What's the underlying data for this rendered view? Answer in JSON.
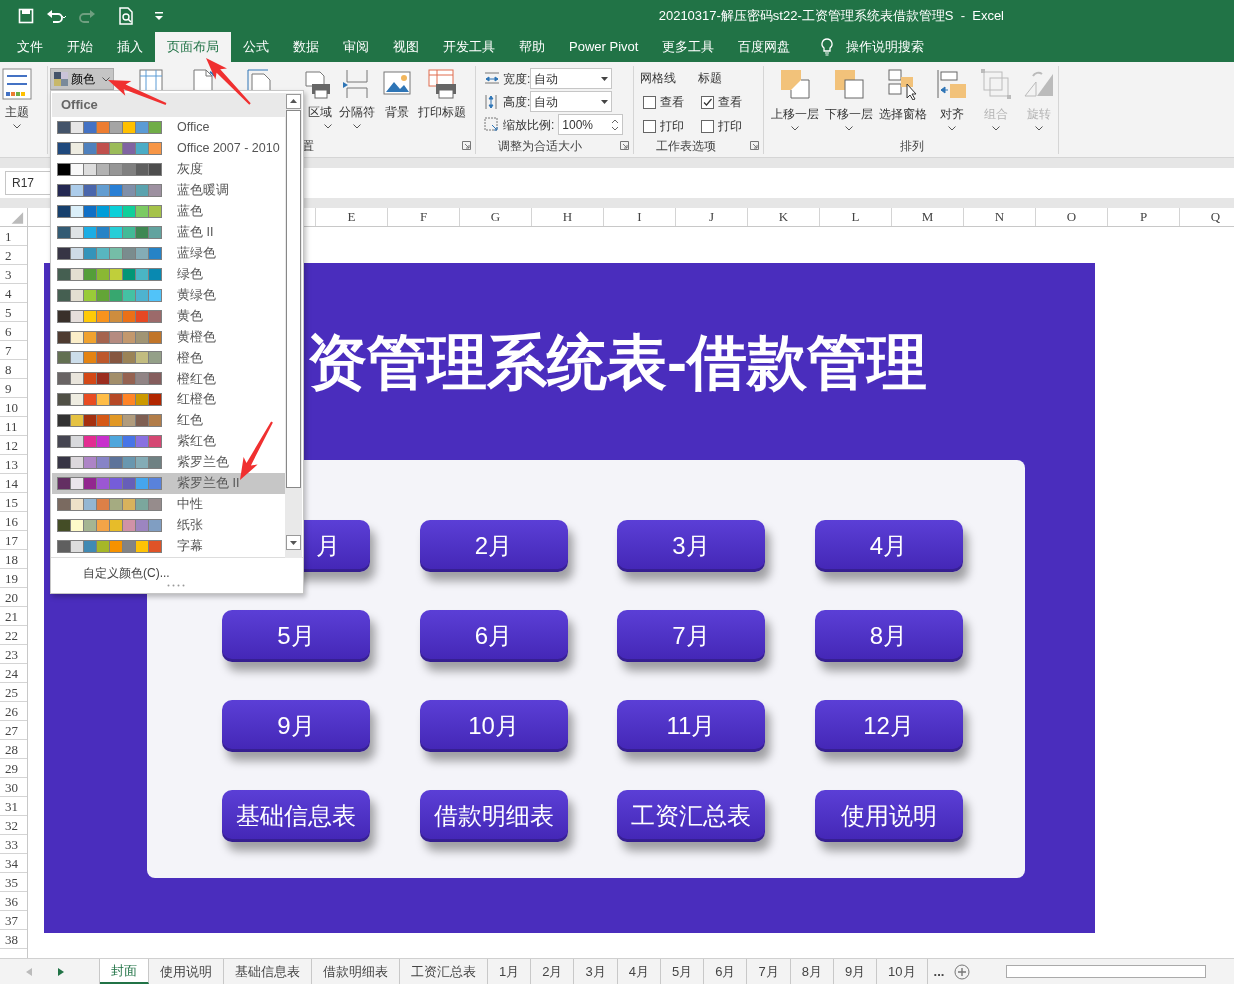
{
  "window": {
    "title": "20210317-解压密码st22-工资管理系统表借款管理S  -  Excel"
  },
  "tabs": [
    {
      "label": "文件",
      "selected": false
    },
    {
      "label": "开始",
      "selected": false
    },
    {
      "label": "插入",
      "selected": false
    },
    {
      "label": "页面布局",
      "selected": true
    },
    {
      "label": "公式",
      "selected": false
    },
    {
      "label": "数据",
      "selected": false
    },
    {
      "label": "审阅",
      "selected": false
    },
    {
      "label": "视图",
      "selected": false
    },
    {
      "label": "开发工具",
      "selected": false
    },
    {
      "label": "帮助",
      "selected": false
    },
    {
      "label": "Power Pivot",
      "selected": false
    },
    {
      "label": "更多工具",
      "selected": false
    },
    {
      "label": "百度网盘",
      "selected": false
    }
  ],
  "tell_me": "操作说明搜索",
  "ribbon": {
    "theme_button": "主题",
    "colors_button": {
      "label": "颜色",
      "pressed": true
    },
    "page_setup": {
      "buttons": [
        {
          "label": "区域",
          "dropdown": true
        },
        {
          "label": "分隔符",
          "dropdown": true
        },
        {
          "label": "背景",
          "dropdown": false
        },
        {
          "label": "打印标题",
          "dropdown": false
        }
      ],
      "group": "置"
    },
    "scale": {
      "fields": [
        {
          "label": "宽度:",
          "value": "自动",
          "kind": "select"
        },
        {
          "label": "高度:",
          "value": "自动",
          "kind": "select"
        },
        {
          "label": "缩放比例:",
          "value": "100%",
          "kind": "spin"
        }
      ],
      "group": "调整为合适大小"
    },
    "sheet_options": {
      "columns": [
        {
          "heading": "网格线",
          "options": [
            {
              "label": "查看",
              "checked": false
            },
            {
              "label": "打印",
              "checked": false
            }
          ]
        },
        {
          "heading": "标题",
          "options": [
            {
              "label": "查看",
              "checked": true
            },
            {
              "label": "打印",
              "checked": false
            }
          ]
        }
      ],
      "group": "工作表选项"
    },
    "arrange": {
      "buttons": [
        {
          "label": "上移一层",
          "dropdown": true,
          "disabled": false
        },
        {
          "label": "下移一层",
          "dropdown": true,
          "disabled": false
        },
        {
          "label": "选择窗格",
          "dropdown": false,
          "disabled": false
        },
        {
          "label": "对齐",
          "dropdown": true,
          "disabled": false
        },
        {
          "label": "组合",
          "dropdown": true,
          "disabled": true
        },
        {
          "label": "旋转",
          "dropdown": true,
          "disabled": true
        }
      ],
      "group": "排列"
    }
  },
  "name_box": "R17",
  "columns": [
    "E",
    "F",
    "G",
    "H",
    "I",
    "J",
    "K",
    "L",
    "M",
    "N",
    "O",
    "P",
    "Q"
  ],
  "rows": [
    "1",
    "2",
    "3",
    "4",
    "5",
    "6",
    "7",
    "8",
    "9",
    "10",
    "11",
    "12",
    "13",
    "14",
    "15",
    "16",
    "17",
    "18",
    "19",
    "20",
    "21",
    "22",
    "23",
    "24",
    "25",
    "26",
    "27",
    "28",
    "29",
    "30",
    "31",
    "32",
    "33",
    "34",
    "35",
    "36",
    "37",
    "38"
  ],
  "sheet": {
    "banner_title": "资管理系统表-借款管理",
    "buttons": [
      "月",
      "2月",
      "3月",
      "4月",
      "5月",
      "6月",
      "7月",
      "8月",
      "9月",
      "10月",
      "11月",
      "12月",
      "基础信息表",
      "借款明细表",
      "工资汇总表",
      "使用说明"
    ]
  },
  "color_menu": {
    "heading": "Office",
    "schemes": [
      {
        "name": "Office",
        "selected": false,
        "swatches": [
          {
            "color": "#44546a"
          },
          {
            "color": "#e7e6e6"
          },
          {
            "color": "#4472c4"
          },
          {
            "color": "#ed7d31"
          },
          {
            "color": "#a5a5a5"
          },
          {
            "color": "#ffc000"
          },
          {
            "color": "#5b9bd5"
          },
          {
            "color": "#70ad47"
          }
        ]
      },
      {
        "name": "Office 2007 - 2010",
        "selected": false,
        "swatches": [
          {
            "color": "#1f497d"
          },
          {
            "color": "#eeece1"
          },
          {
            "color": "#4f81bd"
          },
          {
            "color": "#c0504d"
          },
          {
            "color": "#9bbb59"
          },
          {
            "color": "#8064a2"
          },
          {
            "color": "#4bacc6"
          },
          {
            "color": "#f79646"
          }
        ]
      },
      {
        "name": "灰度",
        "selected": false,
        "swatches": [
          {
            "color": "#000000"
          },
          {
            "color": "#f8f8f8"
          },
          {
            "color": "#dddddd"
          },
          {
            "color": "#b2b2b2"
          },
          {
            "color": "#969696"
          },
          {
            "color": "#808080"
          },
          {
            "color": "#5f5f5f"
          },
          {
            "color": "#4d4d4d"
          }
        ]
      },
      {
        "name": "蓝色暖调",
        "selected": false,
        "swatches": [
          {
            "color": "#242852"
          },
          {
            "color": "#acccea"
          },
          {
            "color": "#4a66ac"
          },
          {
            "color": "#629dd1"
          },
          {
            "color": "#297fd5"
          },
          {
            "color": "#7f8fa9"
          },
          {
            "color": "#5aa2ae"
          },
          {
            "color": "#9d90a0"
          }
        ]
      },
      {
        "name": "蓝色",
        "selected": false,
        "swatches": [
          {
            "color": "#17406d"
          },
          {
            "color": "#dbeff9"
          },
          {
            "color": "#0f6fc6"
          },
          {
            "color": "#009dd9"
          },
          {
            "color": "#0bd0d9"
          },
          {
            "color": "#10cf9b"
          },
          {
            "color": "#7cca62"
          },
          {
            "color": "#a5c249"
          }
        ]
      },
      {
        "name": "蓝色 II",
        "selected": false,
        "swatches": [
          {
            "color": "#335b74"
          },
          {
            "color": "#dfe3e5"
          },
          {
            "color": "#1cade4"
          },
          {
            "color": "#2683c6"
          },
          {
            "color": "#27ced7"
          },
          {
            "color": "#42ba97"
          },
          {
            "color": "#3e8853"
          },
          {
            "color": "#62a39f"
          }
        ]
      },
      {
        "name": "蓝绿色",
        "selected": false,
        "swatches": [
          {
            "color": "#373545"
          },
          {
            "color": "#cedbe6"
          },
          {
            "color": "#3494ba"
          },
          {
            "color": "#58b6c0"
          },
          {
            "color": "#75bda7"
          },
          {
            "color": "#7a8c8e"
          },
          {
            "color": "#84acb6"
          },
          {
            "color": "#2683c6"
          }
        ]
      },
      {
        "name": "绿色",
        "selected": false,
        "swatches": [
          {
            "color": "#455f51"
          },
          {
            "color": "#e3ded1"
          },
          {
            "color": "#549e39"
          },
          {
            "color": "#8ab833"
          },
          {
            "color": "#c0cf3a"
          },
          {
            "color": "#029676"
          },
          {
            "color": "#4ab5c4"
          },
          {
            "color": "#0989b1"
          }
        ]
      },
      {
        "name": "黄绿色",
        "selected": false,
        "swatches": [
          {
            "color": "#455f51"
          },
          {
            "color": "#e3ded1"
          },
          {
            "color": "#99cb38"
          },
          {
            "color": "#63a537"
          },
          {
            "color": "#37a76f"
          },
          {
            "color": "#44c1a3"
          },
          {
            "color": "#4eb3cf"
          },
          {
            "color": "#51c3f9"
          }
        ]
      },
      {
        "name": "黄色",
        "selected": false,
        "swatches": [
          {
            "color": "#39302a"
          },
          {
            "color": "#e5dedb"
          },
          {
            "color": "#ffca08"
          },
          {
            "color": "#f8931d"
          },
          {
            "color": "#ce8d3e"
          },
          {
            "color": "#ec7016"
          },
          {
            "color": "#e64823"
          },
          {
            "color": "#9c6a6a"
          }
        ]
      },
      {
        "name": "黄橙色",
        "selected": false,
        "swatches": [
          {
            "color": "#4e3b30"
          },
          {
            "color": "#fbeec9"
          },
          {
            "color": "#f0a22e"
          },
          {
            "color": "#a5644e"
          },
          {
            "color": "#b58b80"
          },
          {
            "color": "#c3986d"
          },
          {
            "color": "#a19574"
          },
          {
            "color": "#c17529"
          }
        ]
      },
      {
        "name": "橙色",
        "selected": false,
        "swatches": [
          {
            "color": "#637052"
          },
          {
            "color": "#ccddea"
          },
          {
            "color": "#e48312"
          },
          {
            "color": "#bd582c"
          },
          {
            "color": "#865640"
          },
          {
            "color": "#9b8357"
          },
          {
            "color": "#c2bc80"
          },
          {
            "color": "#94a088"
          }
        ]
      },
      {
        "name": "橙红色",
        "selected": false,
        "swatches": [
          {
            "color": "#696464"
          },
          {
            "color": "#e9e5dc"
          },
          {
            "color": "#d34817"
          },
          {
            "color": "#9b2d1f"
          },
          {
            "color": "#a28e6a"
          },
          {
            "color": "#956251"
          },
          {
            "color": "#918485"
          },
          {
            "color": "#855d5d"
          }
        ]
      },
      {
        "name": "红橙色",
        "selected": false,
        "swatches": [
          {
            "color": "#505046"
          },
          {
            "color": "#eeece1"
          },
          {
            "color": "#e84c22"
          },
          {
            "color": "#ffbd47"
          },
          {
            "color": "#b64926"
          },
          {
            "color": "#ff8427"
          },
          {
            "color": "#cc9900"
          },
          {
            "color": "#b22600"
          }
        ]
      },
      {
        "name": "红色",
        "selected": false,
        "swatches": [
          {
            "color": "#323232"
          },
          {
            "color": "#e5c243"
          },
          {
            "color": "#a5300f"
          },
          {
            "color": "#d55816"
          },
          {
            "color": "#e19825"
          },
          {
            "color": "#b19c7d"
          },
          {
            "color": "#7f5f52"
          },
          {
            "color": "#b27d49"
          }
        ]
      },
      {
        "name": "紫红色",
        "selected": false,
        "swatches": [
          {
            "color": "#454551"
          },
          {
            "color": "#d8d9dc"
          },
          {
            "color": "#e32d91"
          },
          {
            "color": "#c830cc"
          },
          {
            "color": "#4ea6dc"
          },
          {
            "color": "#4775e7"
          },
          {
            "color": "#8971e1"
          },
          {
            "color": "#d54773"
          }
        ]
      },
      {
        "name": "紫罗兰色",
        "selected": false,
        "swatches": [
          {
            "color": "#373545"
          },
          {
            "color": "#dcd8dc"
          },
          {
            "color": "#ad84c6"
          },
          {
            "color": "#8784c7"
          },
          {
            "color": "#5d739a"
          },
          {
            "color": "#6997af"
          },
          {
            "color": "#84acb6"
          },
          {
            "color": "#6f8183"
          }
        ]
      },
      {
        "name": "紫罗兰色 II",
        "selected": true,
        "swatches": [
          {
            "color": "#632e62"
          },
          {
            "color": "#eae5eb"
          },
          {
            "color": "#92278f"
          },
          {
            "color": "#9b57d3"
          },
          {
            "color": "#755dd9"
          },
          {
            "color": "#665eb8"
          },
          {
            "color": "#45a5ed"
          },
          {
            "color": "#5982db"
          }
        ]
      },
      {
        "name": "中性",
        "selected": false,
        "swatches": [
          {
            "color": "#7a6a60"
          },
          {
            "color": "#ede1c8"
          },
          {
            "color": "#94b6d2"
          },
          {
            "color": "#dd8047"
          },
          {
            "color": "#a5ab81"
          },
          {
            "color": "#d8b25c"
          },
          {
            "color": "#7ba79d"
          },
          {
            "color": "#968c8c"
          }
        ]
      },
      {
        "name": "纸张",
        "selected": false,
        "swatches": [
          {
            "color": "#444d26"
          },
          {
            "color": "#fefac9"
          },
          {
            "color": "#a5b592"
          },
          {
            "color": "#f3a447"
          },
          {
            "color": "#e7bc29"
          },
          {
            "color": "#d092a7"
          },
          {
            "color": "#9c85c0"
          },
          {
            "color": "#809ec2"
          }
        ]
      },
      {
        "name": "字幕",
        "selected": false,
        "swatches": [
          {
            "color": "#5f5f5f"
          },
          {
            "color": "#dddddd"
          },
          {
            "color": "#418ab3"
          },
          {
            "color": "#a6b727"
          },
          {
            "color": "#f69200"
          },
          {
            "color": "#838383"
          },
          {
            "color": "#fec306"
          },
          {
            "color": "#df5327"
          }
        ]
      }
    ],
    "footer": "自定义颜色(C)..."
  },
  "sheet_tabs": [
    {
      "label": "封面",
      "selected": true
    },
    {
      "label": "使用说明",
      "selected": false
    },
    {
      "label": "基础信息表",
      "selected": false
    },
    {
      "label": "借款明细表",
      "selected": false
    },
    {
      "label": "工资汇总表",
      "selected": false
    },
    {
      "label": "1月",
      "selected": false
    },
    {
      "label": "2月",
      "selected": false
    },
    {
      "label": "3月",
      "selected": false
    },
    {
      "label": "4月",
      "selected": false
    },
    {
      "label": "5月",
      "selected": false
    },
    {
      "label": "6月",
      "selected": false
    },
    {
      "label": "7月",
      "selected": false
    },
    {
      "label": "8月",
      "selected": false
    },
    {
      "label": "9月",
      "selected": false
    },
    {
      "label": "10月",
      "selected": false
    }
  ],
  "more_tabs": "..."
}
